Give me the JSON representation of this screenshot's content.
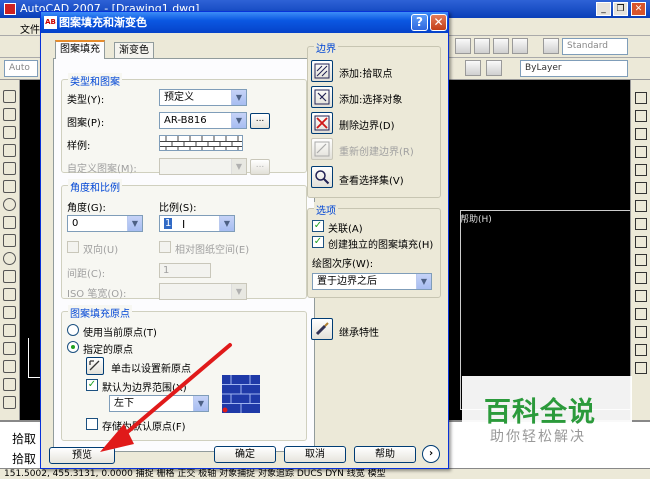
{
  "acad": {
    "title": "AutoCAD 2007 - [Drawing1.dwg]",
    "menu": [
      "文件"
    ],
    "style_combo": "Standard",
    "layer_combo": "ByLayer",
    "auto_combo": "Auto",
    "canvas_help": "帮助(H)",
    "cmd_lines": [
      "拾取",
      "拾取"
    ],
    "status": "151.5002, 455.3131, 0.0000   捕捉 栅格 正交 极轴 对象捕捉 对象追踪 DUCS DYN 线宽 模型"
  },
  "dialog": {
    "title": "图案填充和渐变色",
    "title_icon": "AB",
    "help_label": "?",
    "close_label": "✕",
    "tabs": [
      "图案填充",
      "渐变色"
    ],
    "type_group": {
      "title": "类型和图案",
      "type_label": "类型(Y):",
      "type_value": "预定义",
      "pattern_label": "图案(P):",
      "pattern_value": "AR-B816",
      "browse_label": "...",
      "sample_label": "样例:",
      "custom_label": "自定义图案(M):",
      "custom_browse": "..."
    },
    "angle_group": {
      "title": "角度和比例",
      "angle_label": "角度(G):",
      "angle_value": "0",
      "scale_label": "比例(S):",
      "scale_value": "1",
      "double_label": "双向(U)",
      "relative_label": "相对图纸空间(E)",
      "spacing_label": "间距(C):",
      "spacing_value": "1",
      "iso_label": "ISO 笔宽(O):"
    },
    "origin_group": {
      "title": "图案填充原点",
      "current_label": "使用当前原点(T)",
      "specified_label": "指定的原点",
      "click_label": "单击以设置新原点",
      "default_extent_label": "默认为边界范围(X)",
      "extent_value": "左下",
      "store_label": "存储为默认原点(F)"
    },
    "boundaries": {
      "title": "边界",
      "add_pick": "添加:拾取点",
      "add_select": "添加:选择对象",
      "remove": "删除边界(D)",
      "recreate": "重新创建边界(R)",
      "view": "查看选择集(V)"
    },
    "options": {
      "title": "选项",
      "associative": "关联(A)",
      "separate": "创建独立的图案填充(H)",
      "draw_order_label": "绘图次序(W):",
      "draw_order_value": "置于边界之后",
      "inherit": "继承特性"
    },
    "buttons": {
      "preview": "预览",
      "ok": "确定",
      "cancel": "取消",
      "help": "帮助",
      "more": "›"
    }
  },
  "watermark": {
    "title": "百科全说",
    "subtitle": "助你轻松解决"
  },
  "colors": {
    "accent": "#0b58e2",
    "group_title": "#0046d5",
    "arrow": "#e01a1a",
    "watermark_green": "#2b9a3b"
  }
}
